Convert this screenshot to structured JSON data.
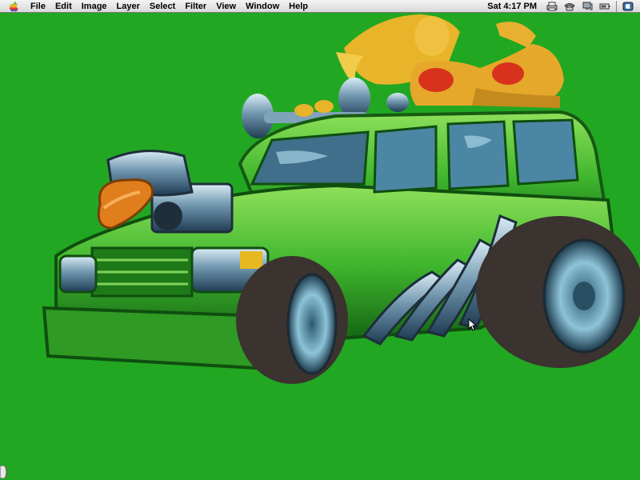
{
  "menubar": {
    "apple_menu": "apple-logo",
    "menus": [
      "File",
      "Edit",
      "Image",
      "Layer",
      "Select",
      "Filter",
      "View",
      "Window",
      "Help"
    ],
    "clock": "Sat 4:17 PM",
    "status_icons": [
      "printer-icon",
      "phone-icon",
      "monitor-icon",
      "battery-icon",
      "app-switcher-icon"
    ]
  },
  "desktop": {
    "background_color": "#22a722",
    "artwork": "cartoon green hot rod wagon with woman lying on roof"
  },
  "colors": {
    "menubar_bg": "#e0e0e0",
    "car_green": "#3fb62e",
    "car_dark": "#166a10",
    "chrome": "#7fa3b8",
    "tire": "#3b3330",
    "tongue": "#e07d1c",
    "skin": "#e8b030",
    "bikini": "#d8321c"
  }
}
